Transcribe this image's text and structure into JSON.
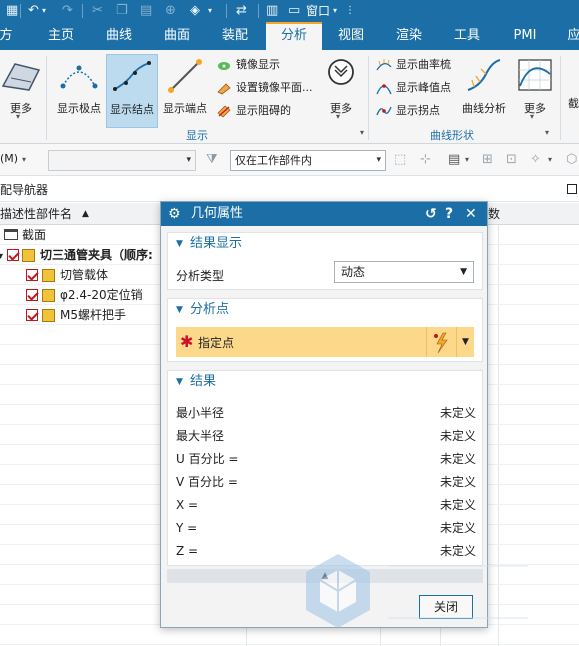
{
  "quick_access": {
    "window_label": "窗口",
    "icons": [
      "undo-icon",
      "redo-icon",
      "cut-icon",
      "copy-icon",
      "paste-icon",
      "insert-icon",
      "touch-mode-icon",
      "switch-window-icon",
      "window-icon"
    ]
  },
  "tabs": [
    {
      "label": "方"
    },
    {
      "label": "主页"
    },
    {
      "label": "曲线"
    },
    {
      "label": "曲面"
    },
    {
      "label": "装配"
    },
    {
      "label": "分析",
      "active": true
    },
    {
      "label": "视图"
    },
    {
      "label": "渲染"
    },
    {
      "label": "工具"
    },
    {
      "label": "PMI"
    },
    {
      "label": "应"
    }
  ],
  "ribbon": {
    "more_label_1": "更多",
    "show_extreme": "显示极点",
    "show_nodes": "显示结点",
    "show_endpoints": "显示端点",
    "mirror_display": "镜像显示",
    "set_mirror_plane": "设置镜像平面...",
    "show_blocked": "显示阻碍的",
    "more_label_2": "更多",
    "group_display": "显示",
    "show_curvature_comb": "显示曲率梳",
    "show_peak": "显示峰值点",
    "show_inflection": "显示拐点",
    "curve_analysis": "曲线分析",
    "more_label_3": "更多",
    "group_curve_shape": "曲线形状",
    "edge_label": "截"
  },
  "selbar": {
    "filter_partial": "(M)",
    "type_combo": "",
    "scope_combo": "仅在工作部件内"
  },
  "navigator": {
    "title": "配导航器",
    "col_name": "描述性部件名",
    "col_extra": "数",
    "rows": [
      {
        "label": "截面"
      },
      {
        "label": "切三通管夹具（顺序:"
      },
      {
        "label": "切管载体"
      },
      {
        "label": "φ2.4-20定位销"
      },
      {
        "label": "M5螺杆把手"
      }
    ]
  },
  "dialog": {
    "title": "几何属性",
    "sec_display": "结果显示",
    "analysis_type_label": "分析类型",
    "analysis_type_value": "动态",
    "sec_points": "分析点",
    "specify_point": "指定点",
    "sec_results": "结果",
    "results": [
      {
        "label": "最小半径",
        "value": "未定义"
      },
      {
        "label": "最大半径",
        "value": "未定义"
      },
      {
        "label": "U 百分比 =",
        "value": "未定义"
      },
      {
        "label": "V 百分比 =",
        "value": "未定义"
      },
      {
        "label": "X =",
        "value": "未定义"
      },
      {
        "label": "Y =",
        "value": "未定义"
      },
      {
        "label": "Z =",
        "value": "未定义"
      }
    ],
    "close_label": "关闭"
  },
  "colors": {
    "accent": "#1b6fa6",
    "active_tab_marker": "#f5a623",
    "highlight": "#fbd88a",
    "required": "#d0102a"
  }
}
